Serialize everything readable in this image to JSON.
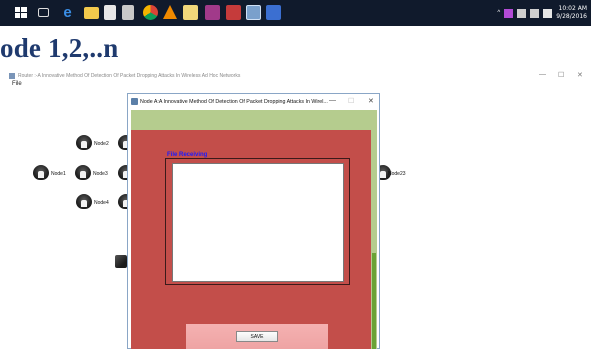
{
  "taskbar": {
    "clock_time": "10:02 AM",
    "clock_date": "9/28/2016",
    "icons": [
      "windows-start-icon",
      "task-view-icon",
      "edge-icon",
      "explorer-icon",
      "store-icon",
      "app-icon",
      "chrome-icon",
      "vlc-icon",
      "app-icon",
      "app-icon",
      "app-icon",
      "java-icon",
      "app-icon"
    ]
  },
  "document": {
    "heading": "ode 1,2,..n"
  },
  "app_window": {
    "title": "Router :-A Innovative Method Of Detection Of Packet Dropping Attacks In Wireless Ad Hoc Networks",
    "menu_file": "File",
    "min_glyph": "—",
    "max_glyph": "☐",
    "close_glyph": "✕"
  },
  "nodes": [
    {
      "label": "Node2"
    },
    {
      "label": "Node1"
    },
    {
      "label": "Node3"
    },
    {
      "label": "Node4"
    },
    {
      "label": "Node23"
    }
  ],
  "dialog": {
    "title": "Node A:A Innovative Method Of Detection Of Packet Dropping Attacks In Wirel...",
    "min_glyph": "—",
    "max_glyph": "☐",
    "close_glyph": "✕",
    "receiving_label": "File Receiving",
    "save_label": "SAVE"
  },
  "colors": {
    "taskbar": "#101a2c",
    "heading": "#1f3a6e",
    "dialog_red": "#c34e4a",
    "dialog_green": "#b5cc8e",
    "legend_blue": "#1a1aff"
  }
}
